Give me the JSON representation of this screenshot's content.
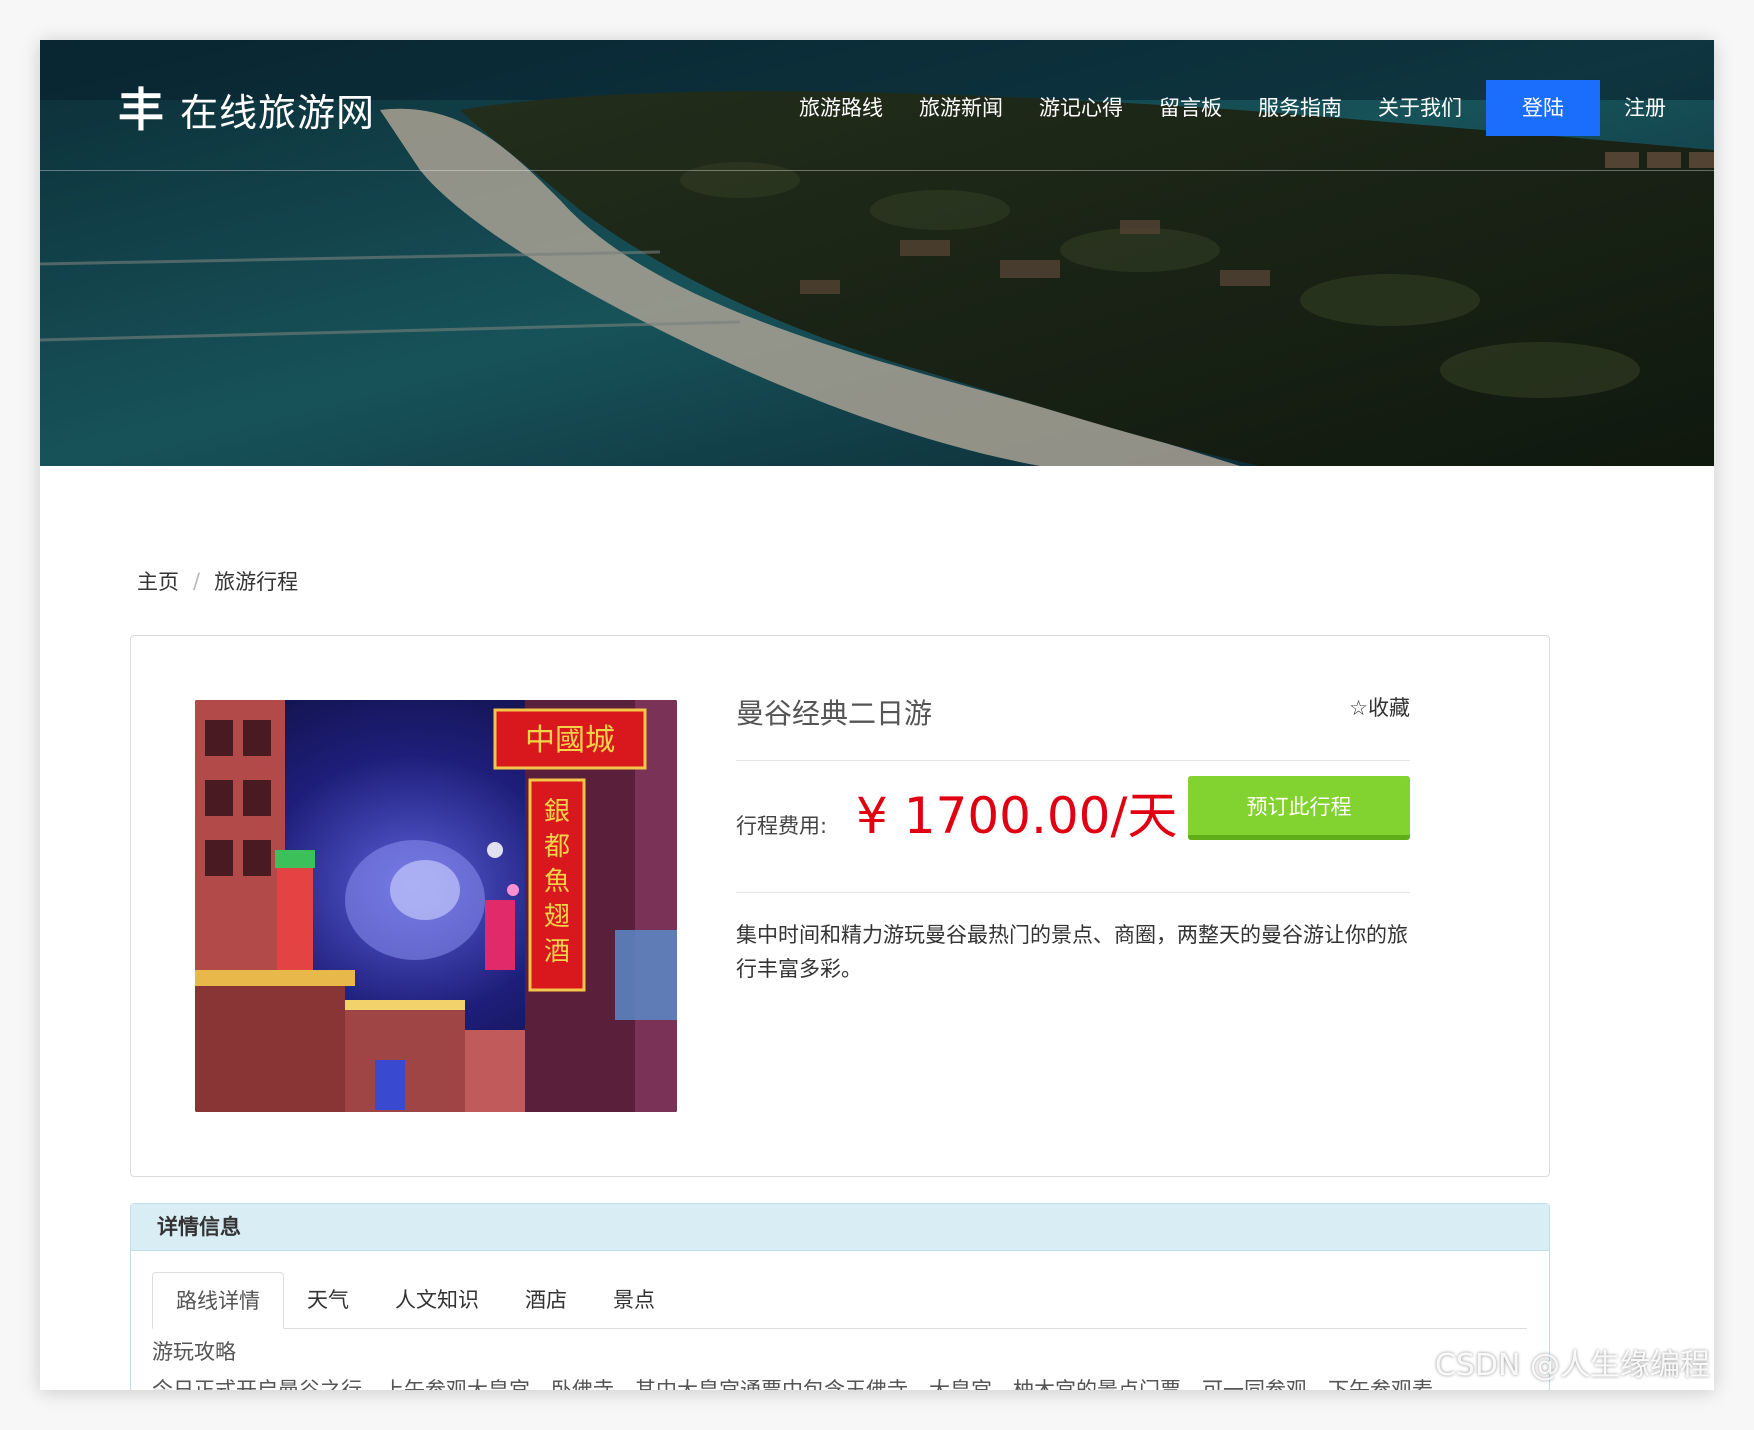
{
  "brand": {
    "icon": "丰",
    "name": "在线旅游网"
  },
  "nav": {
    "items": [
      "旅游路线",
      "旅游新闻",
      "游记心得",
      "留言板",
      "服务指南",
      "关于我们"
    ],
    "login": "登陆",
    "register": "注册",
    "accent": "#1a6efb"
  },
  "breadcrumb": {
    "home": "主页",
    "separator": "/",
    "current": "旅游行程"
  },
  "trip": {
    "title": "曼谷经典二日游",
    "favorite": "☆收藏",
    "price_label": "行程费用:",
    "price": "¥   1700.00/天",
    "price_color": "#e00012",
    "book_button": "预订此行程",
    "book_color": "#82d230",
    "description": "集中时间和精力游玩曼谷最热门的景点、商圈，两整天的曼谷游让你的旅行丰富多彩。",
    "photo_signs": [
      "中國城",
      "銀都魚翅酒樓"
    ]
  },
  "details": {
    "header": "详情信息",
    "tabs": [
      "路线详情",
      "天气",
      "人文知识",
      "酒店",
      "景点"
    ],
    "active_tab": 0,
    "section_title": "游玩攻略",
    "section_text": "今日正式开启曼谷之行，上午参观大皇宫、卧佛寺，其中大皇宫通票中包含玉佛寺、大皇宫、柚木宫的景点门票，可一同参观，下午参观麦"
  },
  "watermark": "CSDN @人生缘编程"
}
